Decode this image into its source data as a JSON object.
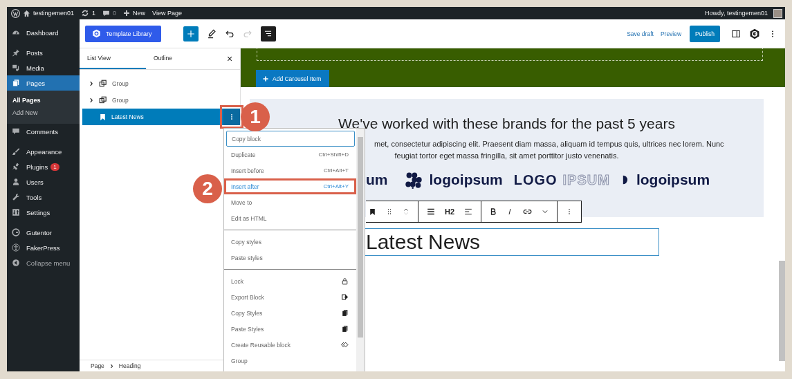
{
  "admin_bar": {
    "site": "testingemen01",
    "updates": "1",
    "comments": "0",
    "new": "New",
    "view_page": "View Page",
    "greeting": "Howdy, testingemen01"
  },
  "sidebar": {
    "groups": [
      [
        {
          "label": "Dashboard",
          "selected": false
        }
      ],
      [
        {
          "label": "Posts",
          "selected": false
        },
        {
          "label": "Media",
          "selected": false
        },
        {
          "label": "Pages",
          "selected": true,
          "children": [
            {
              "label": "All Pages",
              "selected": true
            },
            {
              "label": "Add New",
              "selected": false
            }
          ]
        },
        {
          "label": "Comments",
          "selected": false
        }
      ],
      [
        {
          "label": "Appearance",
          "selected": false
        },
        {
          "label": "Plugins",
          "selected": false,
          "badge": "1"
        },
        {
          "label": "Users",
          "selected": false
        },
        {
          "label": "Tools",
          "selected": false
        },
        {
          "label": "Settings",
          "selected": false
        }
      ],
      [
        {
          "label": "Gutentor",
          "selected": false
        },
        {
          "label": "FakerPress",
          "selected": false
        },
        {
          "label": "Collapse menu",
          "selected": false,
          "dim": true
        }
      ]
    ]
  },
  "toolbar": {
    "template_library": "Template Library",
    "list_view_on": true,
    "redo_disabled": true,
    "save_draft": "Save draft",
    "preview": "Preview",
    "publish": "Publish"
  },
  "panel": {
    "tabs": [
      {
        "label": "List View",
        "selected": true
      },
      {
        "label": "Outline",
        "selected": false
      }
    ],
    "close": "×",
    "items": [
      {
        "label": "Group",
        "expandable": true,
        "selected": false
      },
      {
        "label": "Group",
        "expandable": true,
        "selected": false
      },
      {
        "label": "Latest News",
        "expandable": false,
        "selected": true,
        "callout": "1"
      }
    ],
    "breadcrumb": [
      "Page",
      "Heading"
    ]
  },
  "menu": {
    "sections": [
      [
        {
          "label": "Copy block",
          "focused": true,
          "highlighted": false
        },
        {
          "label": "Duplicate",
          "shortcut": "Ctrl+Shift+D",
          "focused": false,
          "highlighted": false
        },
        {
          "label": "Insert before",
          "shortcut": "Ctrl+Alt+T",
          "focused": false,
          "highlighted": false
        },
        {
          "label": "Insert after",
          "shortcut": "Ctrl+Alt+Y",
          "focused": false,
          "highlighted": true,
          "callout": "2"
        },
        {
          "label": "Move to",
          "focused": false,
          "highlighted": false
        },
        {
          "label": "Edit as HTML",
          "focused": false,
          "highlighted": false
        }
      ],
      [
        {
          "label": "Copy styles",
          "focused": false,
          "highlighted": false
        },
        {
          "label": "Paste styles",
          "focused": false,
          "highlighted": false
        }
      ],
      [
        {
          "label": "Lock",
          "kind": "lock",
          "focused": false,
          "highlighted": false
        },
        {
          "label": "Export Block",
          "kind": "export",
          "focused": false,
          "highlighted": false
        },
        {
          "label": "Copy Styles",
          "kind": "copy",
          "focused": false,
          "highlighted": false
        },
        {
          "label": "Paste Styles",
          "kind": "copy",
          "focused": false,
          "highlighted": false
        },
        {
          "label": "Create Reusable block",
          "kind": "reusable",
          "focused": false,
          "highlighted": false
        },
        {
          "label": "Group",
          "focused": false,
          "highlighted": false
        }
      ]
    ]
  },
  "canvas": {
    "carousel_button": "Add Carousel Item",
    "brands": {
      "heading": "We've worked with these brands for the past 5 years",
      "lines": [
        "met, consectetur adipiscing elit. Praesent diam massa, aliquam id tempus quis, ultrices nec lorem. Nunc",
        "feugiat tortor eget massa fringilla, sit amet porttitor justo venenatis."
      ],
      "logos": [
        {
          "kind": "plain",
          "text": "um"
        },
        {
          "kind": "dots",
          "text": "logoipsum"
        },
        {
          "kind": "split",
          "text": "LOGO",
          "text2": "IPSUM"
        },
        {
          "kind": "half",
          "text": "logoipsum"
        }
      ]
    },
    "block_toolbar": {
      "level": "H2"
    },
    "heading": "Latest News"
  }
}
